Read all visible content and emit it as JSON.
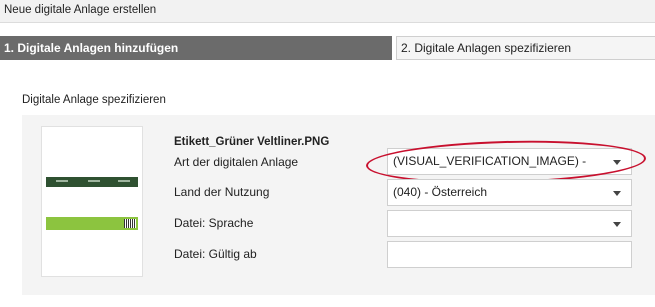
{
  "window": {
    "title": "Neue digitale Anlage erstellen"
  },
  "steps": [
    {
      "label": "1. Digitale Anlagen hinzufügen",
      "active": true
    },
    {
      "label": "2. Digitale Anlagen spezifizieren",
      "active": false
    }
  ],
  "section": {
    "title": "Digitale Anlage spezifizieren"
  },
  "asset": {
    "filename": "Etikett_Grüner Veltliner.PNG",
    "thumbnail_icon": "label-image-thumbnail"
  },
  "form": {
    "type_label": "Art der digitalen Anlage",
    "type_value": "(VISUAL_VERIFICATION_IMAGE) -",
    "country_label": "Land der Nutzung",
    "country_value": "(040) - Österreich",
    "language_label": "Datei: Sprache",
    "language_value": "",
    "valid_from_label": "Datei: Gültig ab",
    "valid_from_value": ""
  },
  "colors": {
    "active_step_bg": "#6b6b6b",
    "highlight_ellipse": "#c8102e",
    "label_dark_green": "#2f5131",
    "label_light_green": "#8cc43f"
  }
}
